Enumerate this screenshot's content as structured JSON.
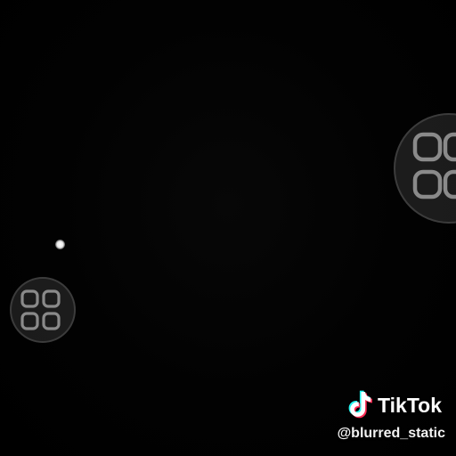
{
  "watermark": {
    "brand": "TikTok",
    "handle": "@blurred_static",
    "logo_icon": "tiktok-note-icon",
    "colors": {
      "cyan": "#25F4EE",
      "red": "#FE2C55",
      "white": "#FFFFFF"
    }
  },
  "floating_buttons": [
    {
      "icon": "grid-menu-icon"
    },
    {
      "icon": "grid-menu-icon"
    }
  ],
  "background_color": "#000000"
}
